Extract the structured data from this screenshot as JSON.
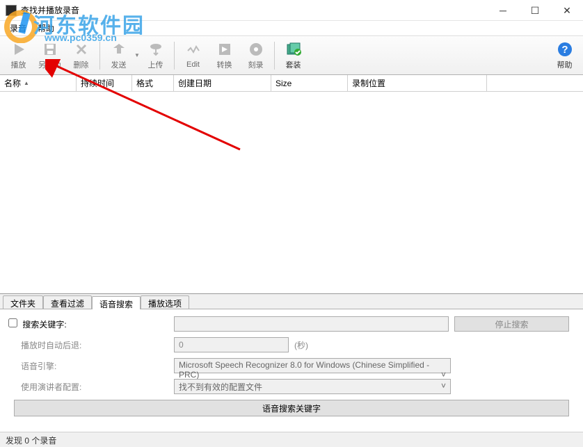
{
  "window": {
    "title": "查找并播放录音",
    "minimize_title": "Minimize",
    "maximize_title": "Maximize",
    "close_title": "Close"
  },
  "menu": {
    "recording": "录音",
    "help": "帮助"
  },
  "toolbar": {
    "play": "播放",
    "save_as": "另存为",
    "delete": "删除",
    "send": "发送",
    "upload": "上传",
    "edit": "Edit",
    "convert": "转换",
    "burn": "刻录",
    "suite": "套装",
    "help": "帮助"
  },
  "columns": {
    "name": "名称",
    "duration": "持续时间",
    "format": "格式",
    "created": "创建日期",
    "size": "Size",
    "location": "录制位置"
  },
  "tabs": {
    "folder": "文件夹",
    "view_filter": "查看过滤",
    "voice_search": "语音搜索",
    "play_options": "播放选项"
  },
  "voice_search": {
    "keyword_label": "搜索关键字:",
    "keyword_value": "",
    "stop_button": "停止搜索",
    "auto_back_label": "播放时自动后退:",
    "auto_back_value": "0",
    "auto_back_suffix": "(秒)",
    "engine_label": "语音引擎:",
    "engine_value": "Microsoft Speech Recognizer 8.0 for Windows (Chinese Simplified - PRC)",
    "speaker_label": "使用演讲者配置:",
    "speaker_value": "找不到有效的配置文件",
    "search_button": "语音搜索关键字"
  },
  "status": {
    "text": "发现 0 个录音"
  },
  "watermark": {
    "site": "河东软件园",
    "url": "www.pc0359.cn"
  },
  "icons": {
    "play": "play-icon",
    "save": "save-icon",
    "delete": "delete-icon",
    "send": "send-icon",
    "upload": "upload-icon",
    "edit": "edit-icon",
    "convert": "convert-icon",
    "burn": "burn-icon",
    "suite": "suite-icon",
    "help": "help-icon"
  }
}
